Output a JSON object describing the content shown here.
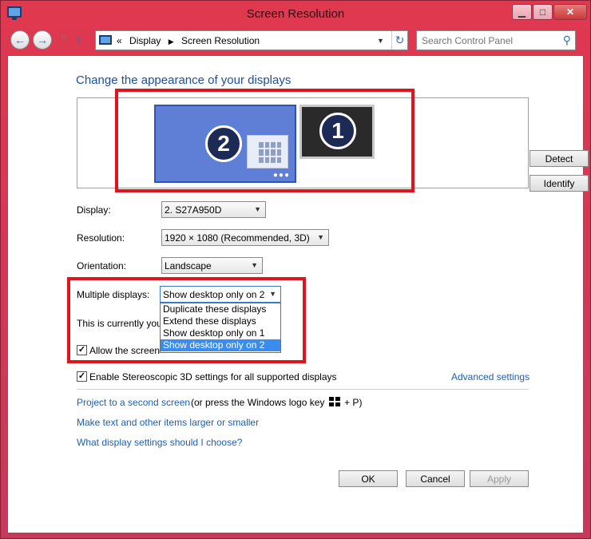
{
  "window": {
    "title": "Screen Resolution"
  },
  "caption": {
    "minimize": "▁",
    "maximize": "□",
    "close": "✕"
  },
  "address": {
    "crumb_prefix": "«",
    "crumbs": [
      "Display",
      "Screen Resolution"
    ],
    "search_placeholder": "Search Control Panel"
  },
  "main": {
    "heading": "Change the appearance of your displays",
    "monitors": [
      {
        "number": "2",
        "selected": true
      },
      {
        "number": "1",
        "selected": false
      }
    ],
    "detect_label": "Detect",
    "identify_label": "Identify",
    "display": {
      "label": "Display:",
      "value": "2. S27A950D"
    },
    "resolution": {
      "label": "Resolution:",
      "value": "1920 × 1080 (Recommended, 3D)"
    },
    "orientation": {
      "label": "Orientation:",
      "value": "Landscape"
    },
    "multiple": {
      "label": "Multiple displays:",
      "value": "Show desktop only on 2",
      "options": [
        "Duplicate these displays",
        "Extend these displays",
        "Show desktop only on 1",
        "Show desktop only on 2"
      ],
      "selected_index": 3
    },
    "current_text": "This is currently you",
    "allow_text": "Allow the screen",
    "stereo_text": "Enable Stereoscopic 3D settings for all supported displays",
    "advanced_link": "Advanced settings",
    "project_link": "Project to a second screen",
    "project_rest_a": "(or press the Windows logo key",
    "project_rest_b": "+ P)",
    "text_larger_link": "Make text and other items larger or smaller",
    "what_settings_link": "What display settings should I choose?",
    "ok_label": "OK",
    "cancel_label": "Cancel",
    "apply_label": "Apply"
  },
  "colors": {
    "highlight_box": "#e0141e",
    "link": "#1e5fb4",
    "dropdown_selected": "#3a8cf0"
  }
}
